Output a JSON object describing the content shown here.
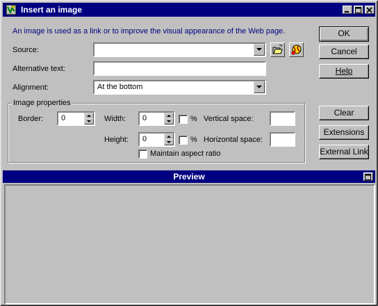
{
  "window": {
    "title": "Insert an image",
    "controls": {
      "minimize": "_",
      "maximize": "□",
      "close": "×"
    }
  },
  "description": "An image is used as a link or to improve the visual appearance of the Web page.",
  "source": {
    "label": "Source:",
    "value": ""
  },
  "alt_text": {
    "label": "Alternative text:",
    "value": ""
  },
  "alignment": {
    "label": "Alignment:",
    "value": "At the bottom"
  },
  "image_properties": {
    "group_label": "Image properties",
    "border": {
      "label": "Border:",
      "value": "0"
    },
    "width": {
      "label": "Width:",
      "value": "0",
      "percent_label": "%"
    },
    "height": {
      "label": "Height:",
      "value": "0",
      "percent_label": "%"
    },
    "vertical_space": {
      "label": "Vertical space:",
      "value": ""
    },
    "horizontal_space": {
      "label": "Horizontal space:",
      "value": ""
    },
    "maintain_aspect": {
      "label": "Maintain aspect ratio",
      "checked": false
    }
  },
  "buttons": {
    "ok": "OK",
    "cancel": "Cancel",
    "help": "Help",
    "clear": "Clear",
    "extensions": "Extensions",
    "external_link": "External Link"
  },
  "preview": {
    "title": "Preview"
  },
  "icons": {
    "app": "app-icon",
    "browse": "folder-open-icon",
    "web": "web-globe-icon",
    "preview_toggle": "panel-toggle-icon"
  },
  "colors": {
    "titlebar": "#000080",
    "description_text": "#000080",
    "face": "#c0c0c0"
  }
}
